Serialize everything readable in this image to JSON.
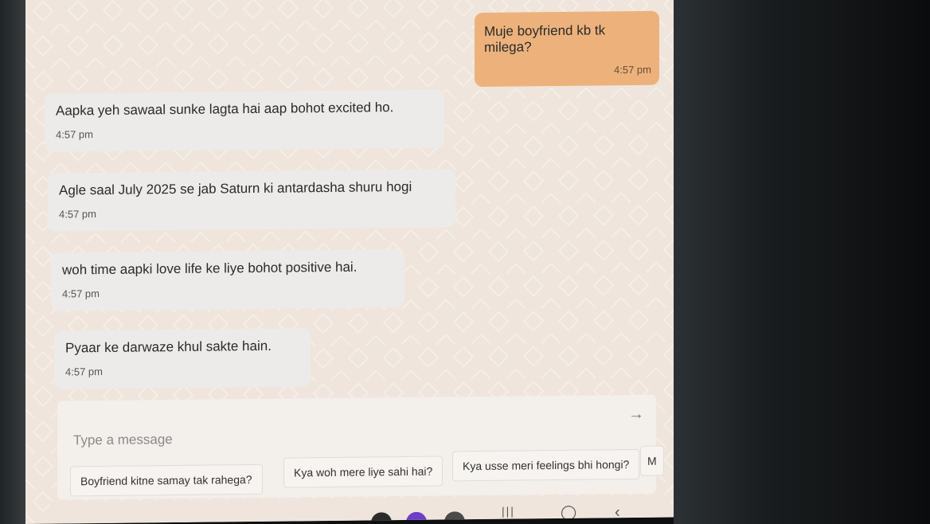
{
  "messages": [
    {
      "side": "out",
      "text": "Muje boyfriend kb tk milega?",
      "time": "4:57 pm"
    },
    {
      "side": "in",
      "text": "Aapka yeh sawaal sunke lagta hai aap bohot excited ho.",
      "time": "4:57 pm"
    },
    {
      "side": "in",
      "text": "Agle saal July 2025 se jab Saturn ki antardasha shuru hogi",
      "time": "4:57 pm"
    },
    {
      "side": "in",
      "text": "woh time aapki love life ke liye bohot positive hai.",
      "time": "4:57 pm"
    },
    {
      "side": "in",
      "text": "Pyaar ke darwaze khul sakte hain.",
      "time": "4:57 pm"
    }
  ],
  "composer": {
    "placeholder": "Type a message",
    "send_icon": "arrow-right-icon"
  },
  "suggestions": [
    "Boyfriend kitne samay tak rahega?",
    "Kya woh mere liye sahi hai?",
    "Kya usse meri feelings bhi hongi?",
    "M"
  ],
  "colors": {
    "outgoing_bubble": "#edb27c",
    "incoming_bubble": "#ecebe9",
    "chat_background": "#efe5dc"
  },
  "system_nav": {
    "icons": [
      "recent-apps-icon",
      "home-icon",
      "back-icon"
    ]
  }
}
